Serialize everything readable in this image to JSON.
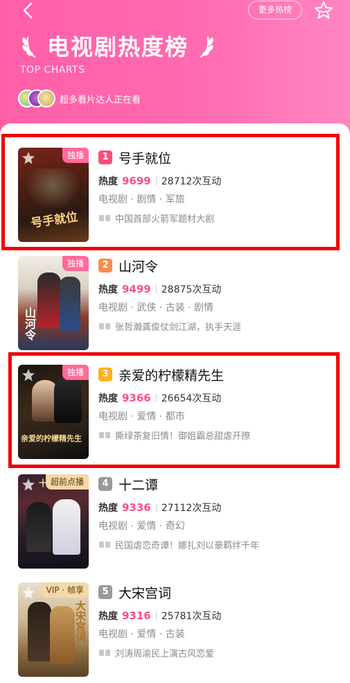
{
  "header": {
    "more_label": "更多热榜",
    "title": "电视剧热度榜",
    "subtitle": "TOP CHARTS",
    "viewers_text": "超多看片达人正在看"
  },
  "colors": {
    "header_pink": "#ff6ab0",
    "heat_pink": "#ff4d88",
    "highlight_red": "#f00000"
  },
  "items": [
    {
      "rank": "1",
      "rank_color": "#ff4d7a",
      "name": "号手就位",
      "tag": "独播",
      "heat_label": "热度",
      "heat": "9699",
      "interactions": "28712次互动",
      "genre": "电视剧 · 剧情 · 军旅",
      "quote": "中国首部火箭军题材大剧",
      "poster_title": "号手就位"
    },
    {
      "rank": "2",
      "rank_color": "#ff8a4a",
      "name": "山河令",
      "tag": "独播",
      "heat_label": "热度",
      "heat": "9499",
      "interactions": "28875次互动",
      "genre": "电视剧 · 武侠 · 古装 · 剧情",
      "quote": "张哲瀚龚俊仗剑江湖，执手天涯",
      "poster_title": "山河令"
    },
    {
      "rank": "3",
      "rank_color": "#ffb21a",
      "name": "亲爱的柠檬精先生",
      "tag": "独播",
      "heat_label": "热度",
      "heat": "9366",
      "interactions": "26654次互动",
      "genre": "电视剧 · 爱情 · 都市",
      "quote": "撕绿茶复旧情！御姐霸总甜虐开撩",
      "poster_title": "亲爱的柠檬精先生"
    },
    {
      "rank": "4",
      "rank_color": "#9a9a9a",
      "name": "十二谭",
      "tag": "超前点播",
      "heat_label": "热度",
      "heat": "9336",
      "interactions": "27112次互动",
      "genre": "电视剧 · 爱情 · 奇幻",
      "quote": "民国虐恋奇谭！娜扎刘以豪羁绊千年",
      "poster_title": "十二谭"
    },
    {
      "rank": "5",
      "rank_color": "#9a9a9a",
      "name": "大宋宫词",
      "tag": "VIP · 帧享",
      "heat_label": "热度",
      "heat": "9316",
      "interactions": "25781次互动",
      "genre": "电视剧 · 爱情 · 古装",
      "quote": "刘涛周渝民上演古风恋爱",
      "poster_title": "大宋宫词"
    }
  ]
}
